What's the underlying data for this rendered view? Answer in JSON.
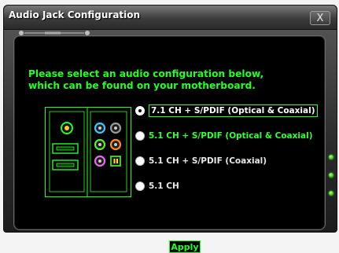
{
  "window": {
    "title": "Audio Jack Configuration",
    "close_label": "X"
  },
  "heading": "Please select an audio configuration below,\nwhich can be found on your motherboard.",
  "options": [
    {
      "label": "7.1 CH + S/PDIF (Optical & Coaxial)",
      "selected": true
    },
    {
      "label": "5.1 CH + S/PDIF (Optical & Coaxial)",
      "selected": false
    },
    {
      "label": "5.1 CH + S/PDIF (Coaxial)",
      "selected": false
    },
    {
      "label": "5.1 CH",
      "selected": false
    }
  ],
  "apply_label": "Apply",
  "colors": {
    "accent": "#22ff22",
    "panel": "#000000",
    "chrome": "#3c3c3c"
  },
  "icons": [
    "close-icon",
    "audio-jack-panel-icon",
    "status-led-icon"
  ]
}
